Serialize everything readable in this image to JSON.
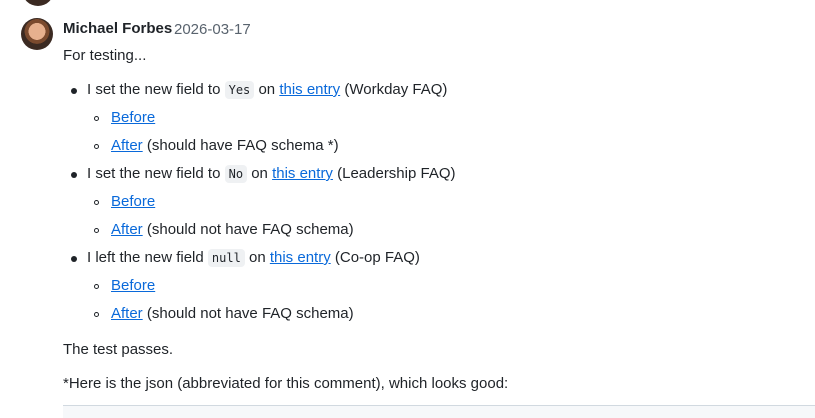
{
  "comment": {
    "author": "Michael Forbes",
    "date": "2026-03-17",
    "intro": "For testing...",
    "items": [
      {
        "text_before": "I set the new field to",
        "code": "Yes",
        "text_mid": "on",
        "link": "this entry",
        "text_after": "(Workday FAQ)",
        "sub": [
          {
            "link": "Before",
            "note": ""
          },
          {
            "link": "After",
            "note": "(should have FAQ schema *)"
          }
        ]
      },
      {
        "text_before": "I set the new field to",
        "code": "No",
        "text_mid": "on",
        "link": "this entry",
        "text_after": "(Leadership FAQ)",
        "sub": [
          {
            "link": "Before",
            "note": ""
          },
          {
            "link": "After",
            "note": "(should not have FAQ schema)"
          }
        ]
      },
      {
        "text_before": "I left the new field",
        "code": "null",
        "text_mid": "on",
        "link": "this entry",
        "text_after": "(Co-op FAQ)",
        "sub": [
          {
            "link": "Before",
            "note": ""
          },
          {
            "link": "After",
            "note": "(should not have FAQ schema)"
          }
        ]
      }
    ],
    "result": "The test passes.",
    "footnote": "*Here is the json (abbreviated for this comment), which looks good:"
  }
}
